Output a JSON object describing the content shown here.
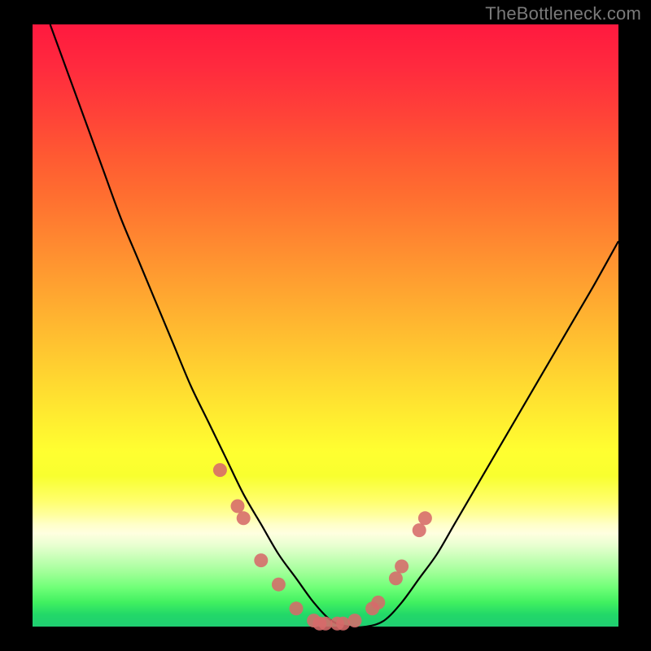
{
  "watermark": "TheBottleneck.com",
  "colors": {
    "background_frame": "#000000",
    "marker": "#d66a6a",
    "curve": "#000000",
    "gradient_top": "#ff193f",
    "gradient_bottom": "#20ce72"
  },
  "chart_data": {
    "type": "line",
    "title": "",
    "xlabel": "",
    "ylabel": "",
    "xlim": [
      0,
      100
    ],
    "ylim": [
      0,
      100
    ],
    "grid": false,
    "legend": false,
    "series": [
      {
        "name": "bottleneck-curve",
        "x": [
          3,
          6,
          9,
          12,
          15,
          18,
          21,
          24,
          27,
          30,
          33,
          36,
          39,
          42,
          45,
          48,
          51,
          54,
          57,
          60,
          63,
          66,
          69,
          72,
          75,
          78,
          81,
          84,
          87,
          90,
          93,
          96,
          100
        ],
        "values": [
          100,
          92,
          84,
          76,
          68,
          61,
          54,
          47,
          40,
          34,
          28,
          22,
          17,
          12,
          8,
          4,
          1,
          0,
          0,
          1,
          4,
          8,
          12,
          17,
          22,
          27,
          32,
          37,
          42,
          47,
          52,
          57,
          64
        ]
      }
    ],
    "markers": {
      "name": "highlight-dots",
      "x": [
        32,
        35,
        36,
        39,
        42,
        45,
        48,
        49,
        50,
        52,
        53,
        55,
        58,
        59,
        62,
        63,
        66,
        67
      ],
      "values": [
        26,
        20,
        18,
        11,
        7,
        3,
        1,
        0.5,
        0.5,
        0.5,
        0.5,
        1,
        3,
        4,
        8,
        10,
        16,
        18
      ]
    }
  }
}
